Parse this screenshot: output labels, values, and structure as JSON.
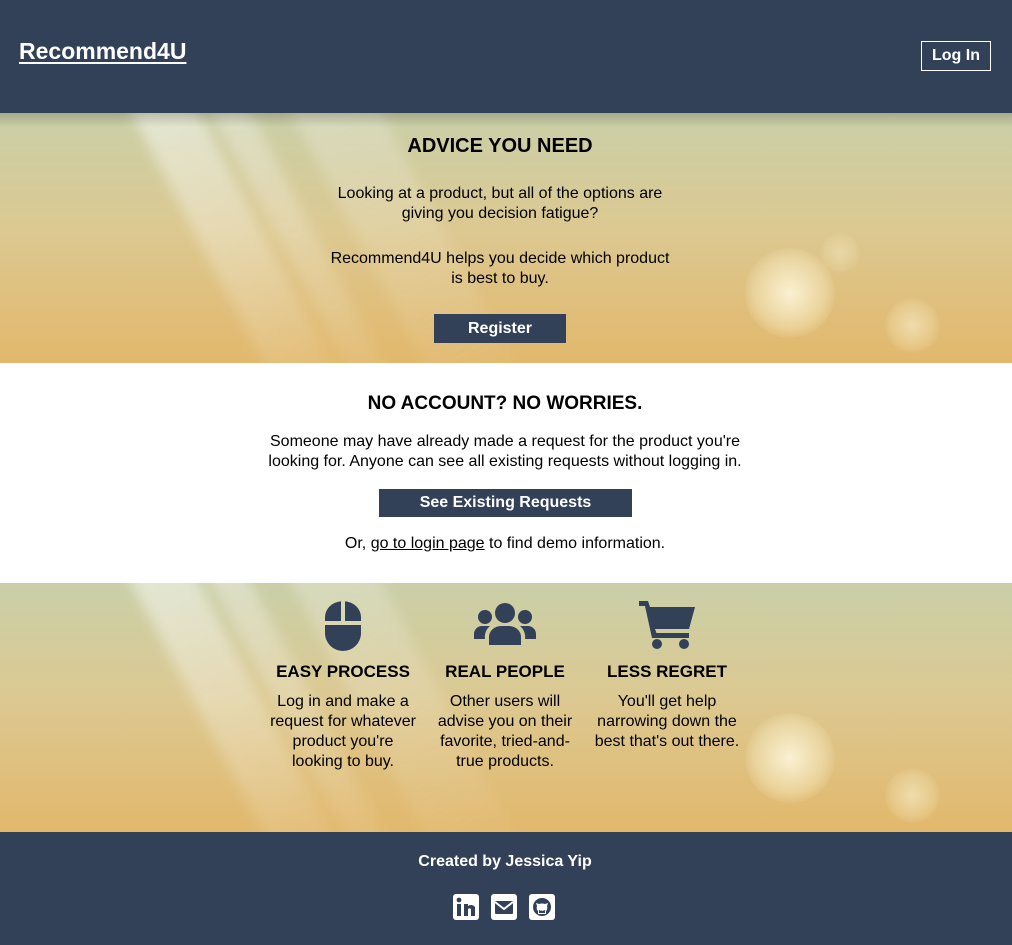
{
  "header": {
    "brand": "Recommend4U",
    "login_label": "Log In"
  },
  "hero": {
    "title": "ADVICE YOU NEED",
    "line1": "Looking at a product, but all of the options are giving you decision fatigue?",
    "line2": "Recommend4U helps you decide which product is best to buy.",
    "register_label": "Register"
  },
  "no_account": {
    "title": "NO ACCOUNT? NO WORRIES.",
    "description": "Someone may have already made a request for the product you're looking for. Anyone can see all existing requests without logging in.",
    "see_requests_label": "See Existing Requests",
    "or_prefix": "Or,",
    "login_link": "go to login page",
    "or_suffix": "to find demo information."
  },
  "features": [
    {
      "icon": "mouse-icon",
      "title": "EASY PROCESS",
      "text": "Log in and make a request for whatever product you're looking to buy."
    },
    {
      "icon": "users-icon",
      "title": "REAL PEOPLE",
      "text": "Other users will advise you on their favorite, tried-and-true products."
    },
    {
      "icon": "cart-icon",
      "title": "LESS REGRET",
      "text": "You'll get help narrowing down the best that's out there."
    }
  ],
  "footer": {
    "credit": "Created by Jessica Yip",
    "socials": [
      "linkedin-icon",
      "envelope-icon",
      "github-icon"
    ]
  },
  "colors": {
    "navy": "#324058",
    "gold": "#e2b86c",
    "sage": "#c9cfa8"
  }
}
